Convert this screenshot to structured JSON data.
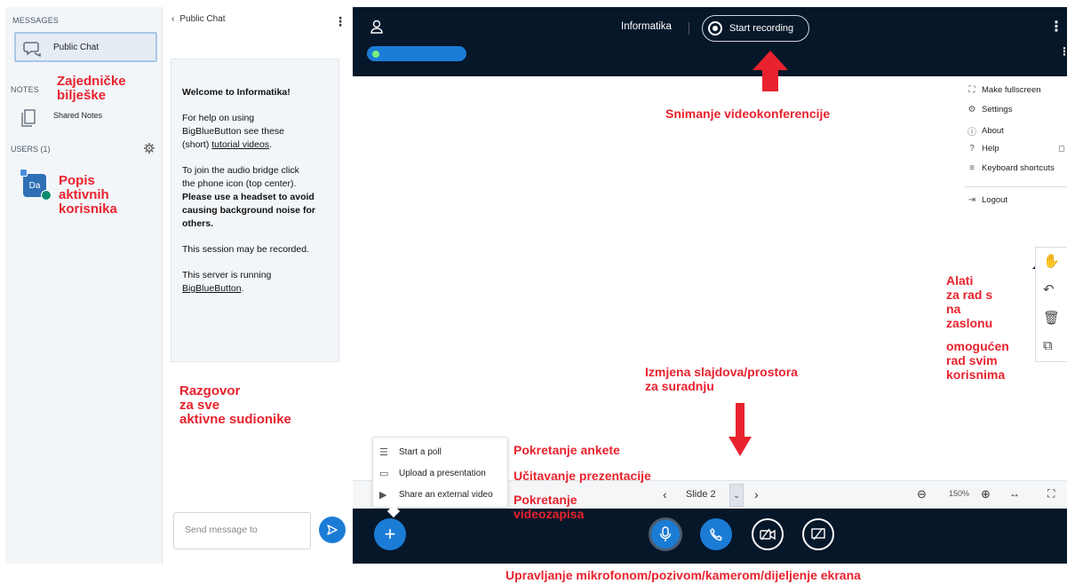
{
  "left_panel": {
    "messages_title": "MESSAGES",
    "public_chat_label": "Public Chat",
    "notes_title": "NOTES",
    "shared_notes_label": "Shared Notes",
    "users_title": "USERS (1)",
    "user_avatar": "Da"
  },
  "chat": {
    "header_title": "Public Chat",
    "welcome_title": "Welcome to Informatika!",
    "help_line1": "For help on using",
    "help_line2": "BigBlueButton see these",
    "help_prefix": "(short) ",
    "help_link": "tutorial videos",
    "help_suffix": ".",
    "audio_line1": "To join the audio bridge click",
    "audio_line2": "the phone icon (top center).",
    "audio_bold1": "Please use a headset to avoid",
    "audio_bold2": "causing background noise for",
    "audio_bold3": "others.",
    "recorded": "This session may be recorded.",
    "server_line": "This server is running",
    "server_link": "BigBlueButton",
    "server_suffix": ".",
    "input_placeholder": "Send message to"
  },
  "top_bar": {
    "meeting_title": "Informatika",
    "recording_label": "Start recording"
  },
  "dropdown": {
    "items": [
      {
        "label": "Make fullscreen",
        "icon": "fullscreen-icon"
      },
      {
        "label": "Settings",
        "icon": "settings-icon"
      },
      {
        "label": "About",
        "icon": "info-icon"
      },
      {
        "label": "Help",
        "icon": "help-icon"
      },
      {
        "label": "Keyboard shortcuts",
        "icon": "keyboard-icon"
      },
      {
        "label": "Logout",
        "icon": "logout-icon"
      }
    ]
  },
  "actions_menu": {
    "items": [
      {
        "label": "Start a poll",
        "icon": "poll-icon"
      },
      {
        "label": "Upload a presentation",
        "icon": "presentation-icon"
      },
      {
        "label": "Share an external video",
        "icon": "video-icon"
      }
    ]
  },
  "slide_bar": {
    "slide_label": "Slide 2",
    "zoom": "150%"
  },
  "annotations": {
    "notes": [
      "Zajedničke",
      "bilješke"
    ],
    "users": [
      "Popis",
      "aktivnih",
      "korisnika"
    ],
    "chat": [
      "Razgovor",
      "za sve",
      "aktivne sudionike"
    ],
    "recording": "Snimanje videokonferencije",
    "tools": [
      "Alati",
      "za rad s",
      "na",
      "zaslonu"
    ],
    "tools_enabled": [
      "omogućen",
      "rad svim",
      "korisnima"
    ],
    "slides": [
      "Izmjena slajdova/prostora",
      "za suradnju"
    ],
    "poll": "Pokretanje ankete",
    "upload": "Učitavanje prezentacije",
    "video": [
      "Pokretanje",
      "videozapisa"
    ],
    "controls": "Upravljanje mikrofonom/pozivom/kamerom/dijeljenje ekrana"
  },
  "colors": {
    "annotation_red": "#e8222e",
    "accent_blue": "#1b7cd6",
    "dark_bg": "#06172a"
  }
}
